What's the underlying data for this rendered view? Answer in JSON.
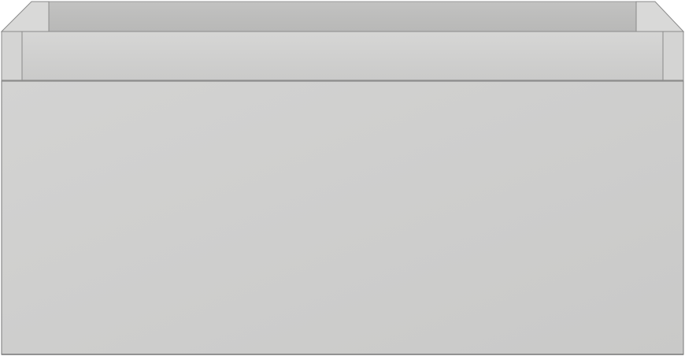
{
  "product": {
    "subject": "drawer-box",
    "finish_color": "#cfcfce",
    "interior_color": "#bdbdbc",
    "edge_color": "#8a8a8a"
  }
}
